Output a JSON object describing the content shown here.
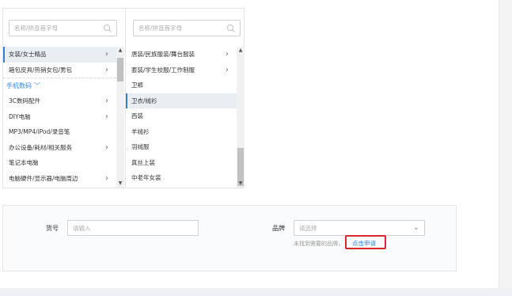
{
  "left_panel": {
    "search_placeholder": "名称/拼音首字母",
    "items_before_group": [
      {
        "label": "女装/女士精品",
        "has_children": true,
        "selected": true
      },
      {
        "label": "箱包皮具/热销女包/男包",
        "has_children": true,
        "selected": false
      }
    ],
    "group": {
      "title": "手机数码"
    },
    "items_after_group": [
      {
        "label": "3C数码配件",
        "has_children": true
      },
      {
        "label": "DIY电脑",
        "has_children": true
      },
      {
        "label": "MP3/MP4/iPod/录音笔",
        "has_children": false
      },
      {
        "label": "办公设备/耗材/相关服务",
        "has_children": true
      },
      {
        "label": "笔记本电脑",
        "has_children": false
      },
      {
        "label": "电脑硬件/显示器/电脑周边",
        "has_children": true
      }
    ]
  },
  "right_panel": {
    "search_placeholder": "名称/拼音首字母",
    "items": [
      {
        "label": "唐装/民族服装/舞台服装",
        "has_children": true,
        "selected": false
      },
      {
        "label": "套装/学生校服/工作制服",
        "has_children": true,
        "selected": false
      },
      {
        "label": "卫裤",
        "has_children": false,
        "selected": false
      },
      {
        "label": "卫衣/绒衫",
        "has_children": false,
        "selected": true
      },
      {
        "label": "西装",
        "has_children": false,
        "selected": false
      },
      {
        "label": "羊绒衫",
        "has_children": false,
        "selected": false
      },
      {
        "label": "羽绒服",
        "has_children": false,
        "selected": false
      },
      {
        "label": "真丝上装",
        "has_children": false,
        "selected": false
      },
      {
        "label": "中老年女装",
        "has_children": false,
        "selected": false
      }
    ]
  },
  "form": {
    "item_no_label": "货号",
    "item_no_placeholder": "请输入",
    "brand_label": "品牌",
    "brand_placeholder": "请选择",
    "brand_hint": "未找到需要的品牌，",
    "apply_link": "点击申请"
  },
  "colors": {
    "accent": "#3a87d6",
    "highlight_box": "#d9272e",
    "link": "#2f7ed8"
  }
}
